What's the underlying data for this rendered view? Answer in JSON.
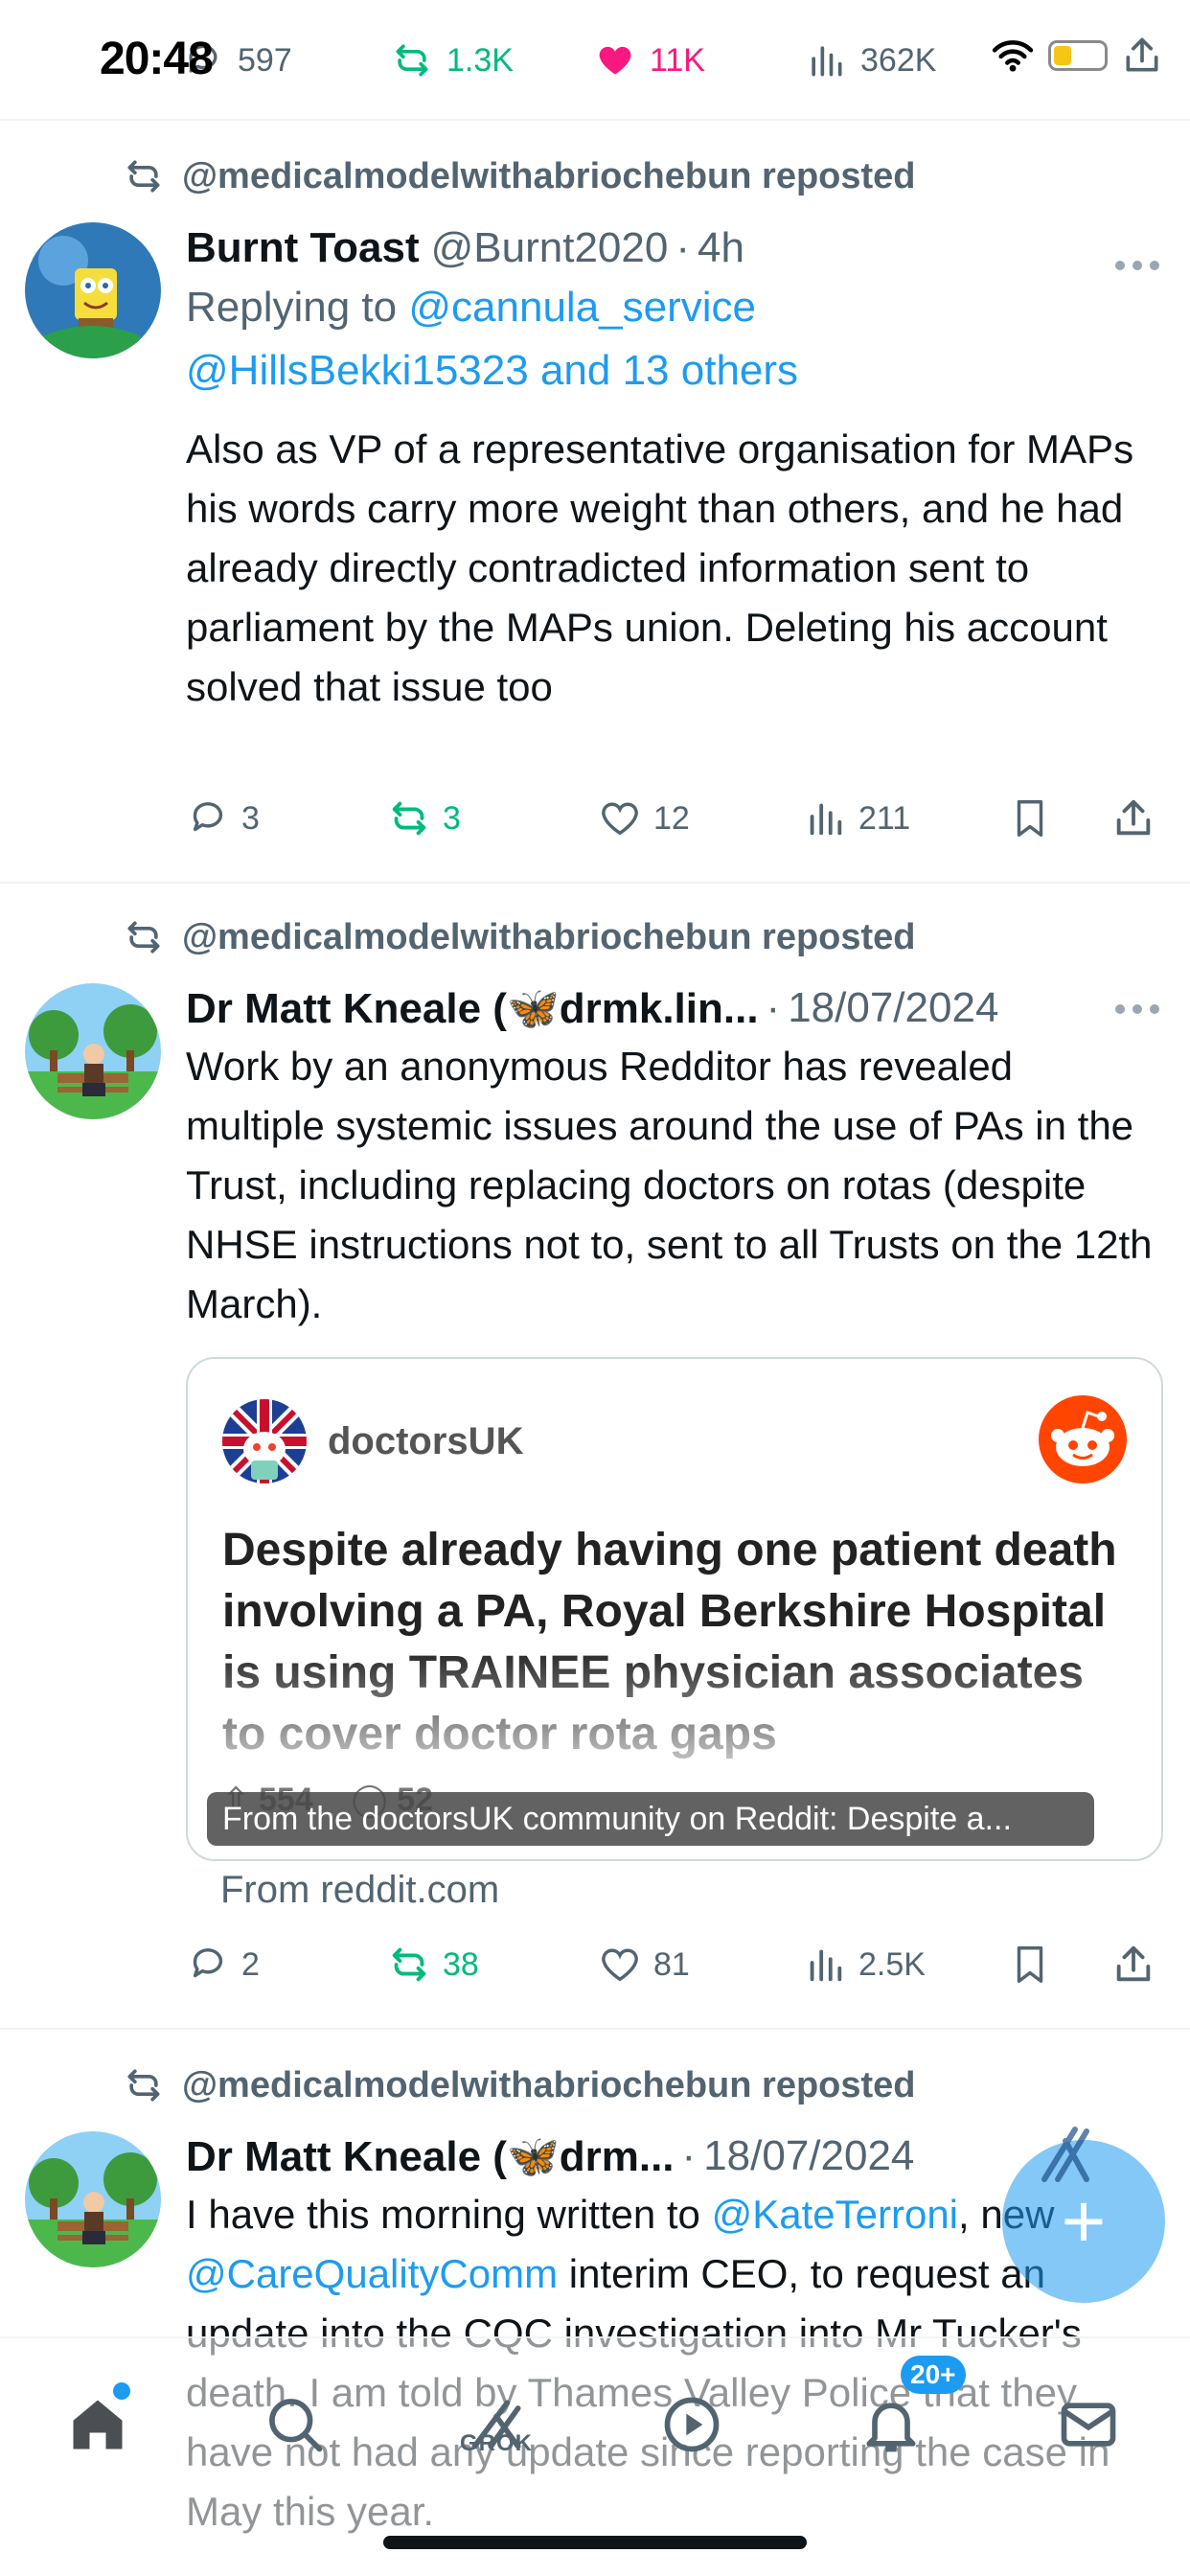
{
  "status_bar": {
    "time": "20:48"
  },
  "top_actions": {
    "replies": "597",
    "reposts": "1.3K",
    "likes": "11K",
    "views": "362K"
  },
  "tweets": [
    {
      "repost_label": "@medicalmodelwithabriochebun reposted",
      "name": "Burnt Toast",
      "handle": "@Burnt2020",
      "time": "4h",
      "reply_prefix": "Replying to",
      "reply_handle_1": "@cannula_service",
      "reply_handle_2": "@HillsBekki15323 and 13 others",
      "text": "Also as VP of a representative organisation for MAPs his words carry more weight than others, and he had already directly contradicted information sent to parliament by the MAPs union. Deleting his account solved that issue too",
      "stats": {
        "replies": "3",
        "reposts": "3",
        "likes": "12",
        "views": "211"
      }
    },
    {
      "repost_label": "@medicalmodelwithabriochebun reposted",
      "name": "Dr Matt Kneale (🦋drmk.lin...",
      "time": "18/07/2024",
      "text": "Work by an anonymous Redditor has revealed multiple systemic issues around the use of PAs in the Trust, including replacing doctors on rotas (despite NHSE instructions not to, sent to all Trusts on the 12th March).",
      "card": {
        "subreddit": "doctorsUK",
        "headline": "Despite already having one patient death involving a PA, Royal Berkshire Hospital is using TRAINEE physician associates to cover doctor rota gaps",
        "upvotes": "554",
        "comments": "52",
        "caption": "From the doctorsUK community on Reddit: Despite a...",
        "source": "From reddit.com"
      },
      "stats": {
        "replies": "2",
        "reposts": "38",
        "likes": "81",
        "views": "2.5K"
      }
    },
    {
      "repost_label": "@medicalmodelwithabriochebun reposted",
      "name": "Dr Matt Kneale (🦋drm...",
      "time": "18/07/2024",
      "text_1": "I have this morning written to ",
      "mention_1": "@KateTerroni",
      "text_2": ", new ",
      "mention_2": "@CareQualityComm",
      "text_3": " interim CEO, to request an update into the CQC investigation into Mr Tucker's death. I am told by Thames Valley Police that they have not had any update since reporting the case in May this year."
    }
  ],
  "fab": {
    "label": "+"
  },
  "bottom_nav": {
    "grok_label": "GROK",
    "notification_badge": "20+"
  },
  "colors": {
    "accent": "#1d9bf0",
    "repost_green": "#00ba7c",
    "like_pink": "#f91880",
    "secondary_text": "#536471"
  }
}
